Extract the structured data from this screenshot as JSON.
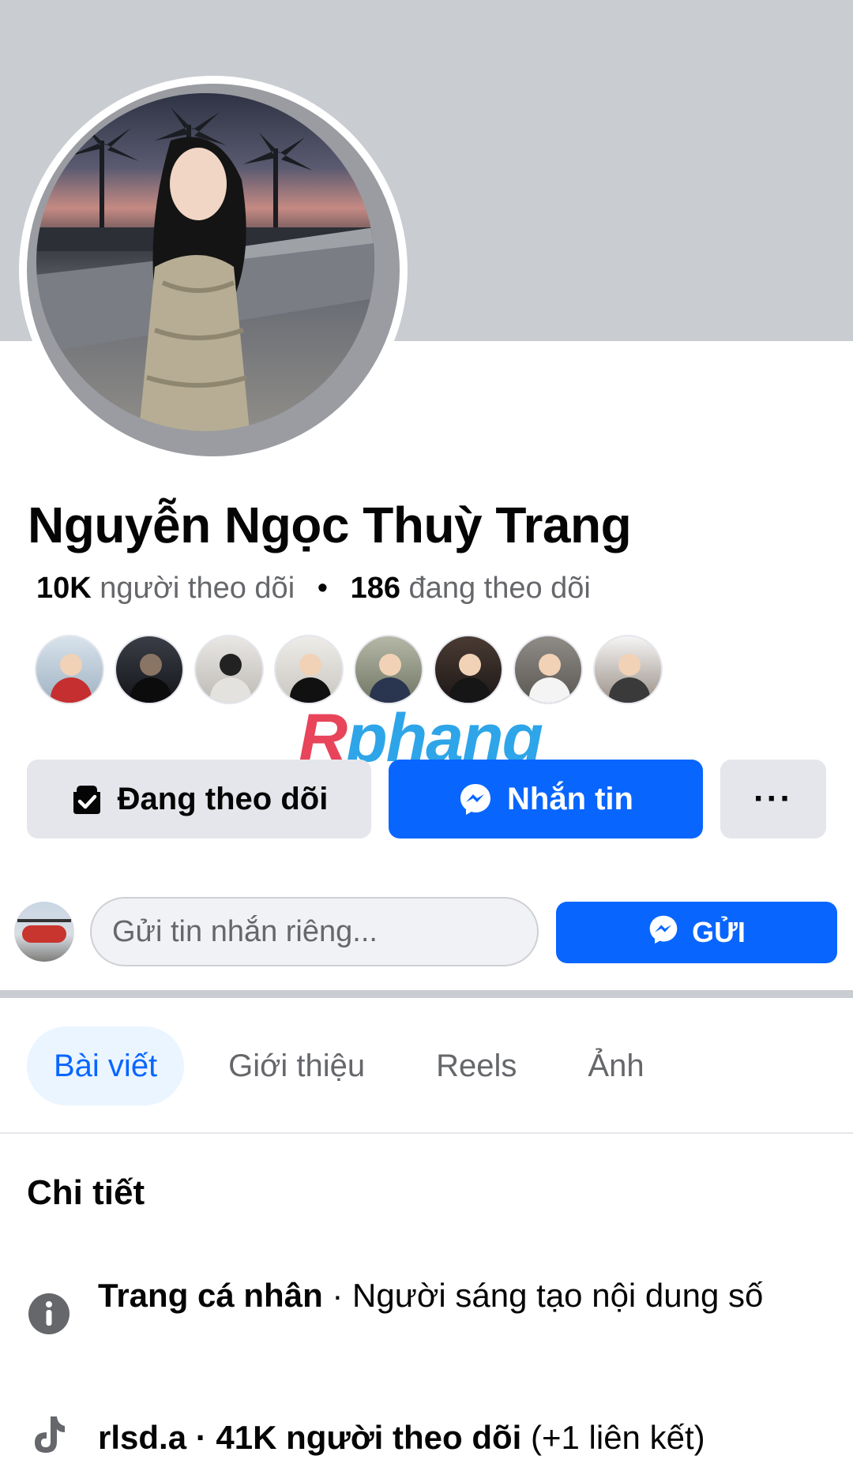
{
  "profile": {
    "name": "Nguyễn Ngọc Thuỳ Trang",
    "followers_count": "10K",
    "followers_label": "người theo dõi",
    "separator": "•",
    "following_count": "186",
    "following_label": "đang theo dõi"
  },
  "watermark": {
    "first": "R",
    "rest": "phang"
  },
  "actions": {
    "follow_label": "Đang theo dõi",
    "message_label": "Nhắn tin",
    "more_label": "···"
  },
  "private_message": {
    "placeholder": "Gửi tin nhắn riêng...",
    "send_label": "GỬI"
  },
  "tabs": [
    {
      "label": "Bài viết",
      "active": true
    },
    {
      "label": "Giới thiệu",
      "active": false
    },
    {
      "label": "Reels",
      "active": false
    },
    {
      "label": "Ảnh",
      "active": false
    }
  ],
  "details": {
    "title": "Chi tiết",
    "items": [
      {
        "icon": "info-icon",
        "bold": "Trang cá nhân",
        "rest": " · Người sáng tạo nội dung số"
      },
      {
        "icon": "tiktok-icon",
        "bold": "rlsd.a · 41K người theo dõi",
        "rest": " (+1 liên kết)"
      }
    ]
  },
  "colors": {
    "accent": "#0866ff",
    "cover": "#c9ccd1",
    "secondary_button": "#e4e6eb",
    "muted_text": "#65676b",
    "active_tab_bg": "#ebf5ff"
  }
}
